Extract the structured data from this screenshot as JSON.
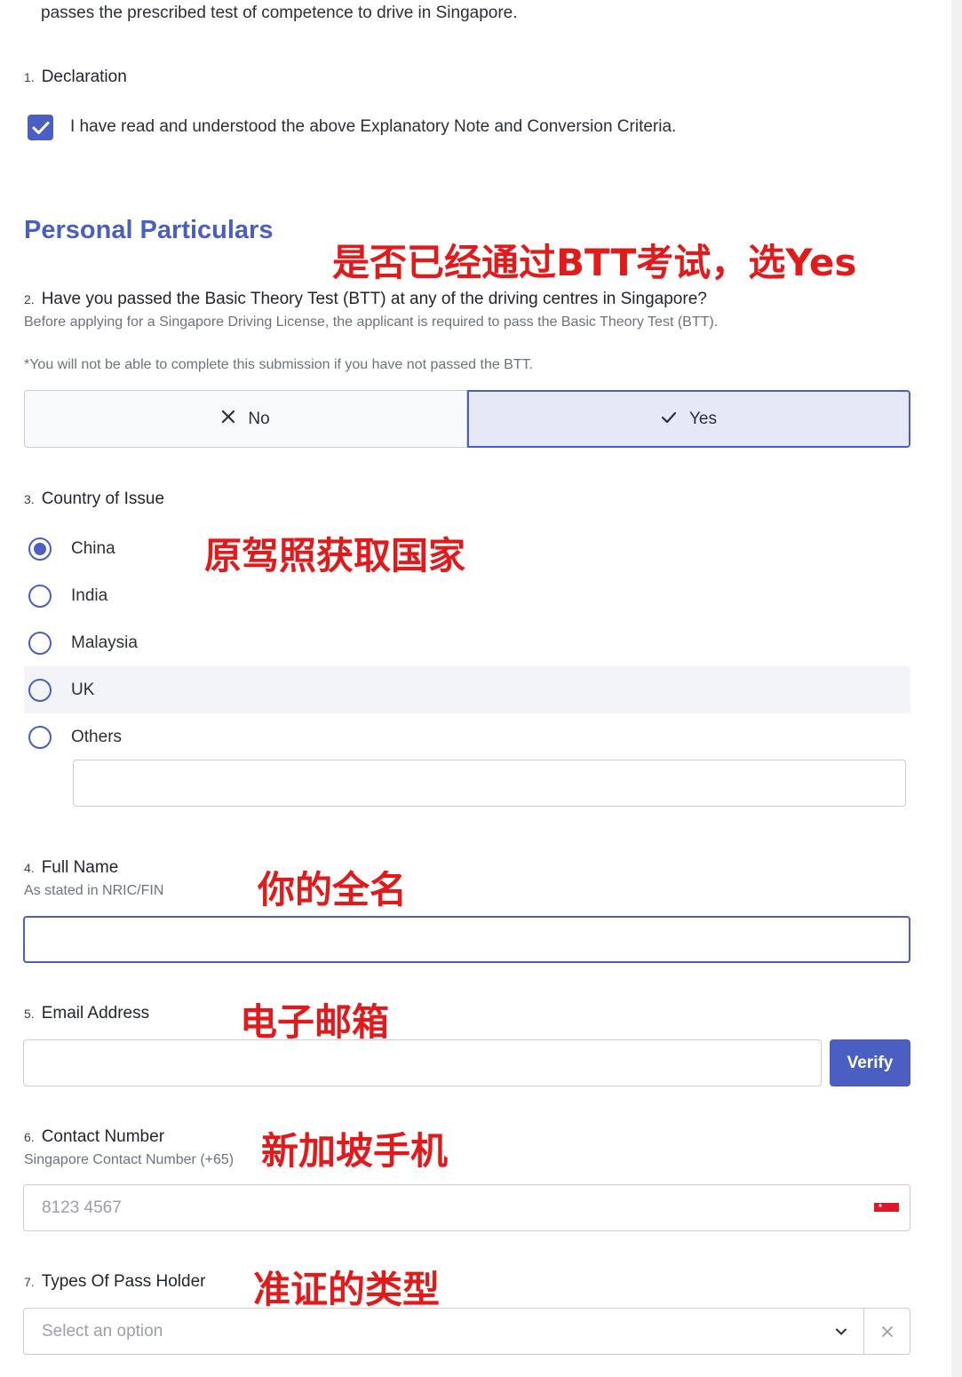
{
  "intro": {
    "text": "passes the prescribed test of competence to drive in Singapore."
  },
  "declaration": {
    "number": "1.",
    "title": "Declaration",
    "checkbox_label": "I have read and understood the above Explanatory Note and Conversion Criteria.",
    "checked": true
  },
  "section": {
    "title": "Personal Particulars"
  },
  "btt": {
    "number": "2.",
    "title": "Have you passed the Basic Theory Test (BTT) at any of the driving centres in Singapore?",
    "description": "Before applying for a Singapore Driving License, the applicant is required to pass the Basic Theory Test (BTT).",
    "warning": "*You will not be able to complete this submission if you have not passed the BTT.",
    "no_label": "No",
    "yes_label": "Yes",
    "selected": "Yes"
  },
  "country": {
    "number": "3.",
    "title": "Country of Issue",
    "options": [
      "China",
      "India",
      "Malaysia",
      "UK",
      "Others"
    ],
    "selected": "China",
    "others_value": ""
  },
  "full_name": {
    "number": "4.",
    "title": "Full Name",
    "description": "As stated in NRIC/FIN",
    "value": ""
  },
  "email": {
    "number": "5.",
    "title": "Email Address",
    "value": "",
    "verify_label": "Verify"
  },
  "contact": {
    "number": "6.",
    "title": "Contact Number",
    "description": "Singapore Contact Number (+65)",
    "placeholder": "8123 4567"
  },
  "pass_type": {
    "number": "7.",
    "title": "Types Of Pass Holder",
    "placeholder": "Select an option"
  },
  "annotations": {
    "btt": "是否已经通过BTT考试，选Yes",
    "country": "原驾照获取国家",
    "name": "你的全名",
    "email": "电子邮箱",
    "phone": "新加坡手机",
    "pass": "准证的类型"
  },
  "colors": {
    "accent": "#4a5fc1",
    "annotation": "#e11b1b"
  },
  "icons": {
    "check": "check-icon",
    "close": "close-icon",
    "chevron": "chevron-down-icon",
    "flag": "singapore-flag-icon"
  }
}
